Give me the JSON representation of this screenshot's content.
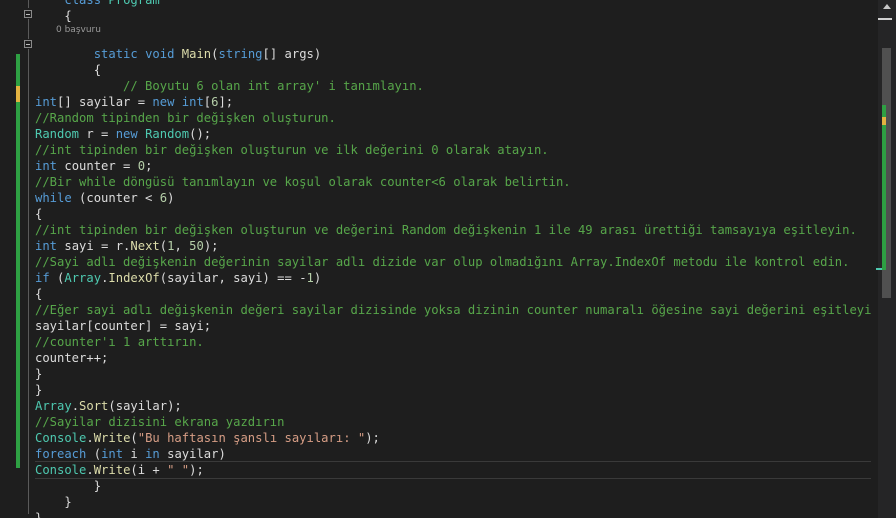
{
  "editor": {
    "codelens": "0 başvuru",
    "lines": [
      [
        {
          "c": "",
          "t": "    "
        },
        {
          "c": "t-kw",
          "t": "class"
        },
        {
          "c": "",
          "t": " "
        },
        {
          "c": "t-type",
          "t": "Program"
        }
      ],
      [
        {
          "c": "",
          "t": "    {"
        }
      ],
      [],
      [
        {
          "c": "",
          "t": "        "
        },
        {
          "c": "t-kw",
          "t": "static"
        },
        {
          "c": "",
          "t": " "
        },
        {
          "c": "t-kw",
          "t": "void"
        },
        {
          "c": "",
          "t": " "
        },
        {
          "c": "t-mth",
          "t": "Main"
        },
        {
          "c": "",
          "t": "("
        },
        {
          "c": "t-kw",
          "t": "string"
        },
        {
          "c": "",
          "t": "[] args)"
        }
      ],
      [
        {
          "c": "",
          "t": "        {"
        }
      ],
      [
        {
          "c": "t-cm",
          "t": "            // Boyutu 6 olan int array' i tanımlayın."
        }
      ],
      [
        {
          "c": "t-kw",
          "t": "int"
        },
        {
          "c": "",
          "t": "[] sayilar = "
        },
        {
          "c": "t-kw",
          "t": "new"
        },
        {
          "c": "",
          "t": " "
        },
        {
          "c": "t-kw",
          "t": "int"
        },
        {
          "c": "",
          "t": "["
        },
        {
          "c": "t-num",
          "t": "6"
        },
        {
          "c": "",
          "t": "];"
        }
      ],
      [
        {
          "c": "t-cm",
          "t": "//Random tipinden bir değişken oluşturun."
        }
      ],
      [
        {
          "c": "t-type",
          "t": "Random"
        },
        {
          "c": "",
          "t": " r = "
        },
        {
          "c": "t-kw",
          "t": "new"
        },
        {
          "c": "",
          "t": " "
        },
        {
          "c": "t-type",
          "t": "Random"
        },
        {
          "c": "",
          "t": "();"
        }
      ],
      [
        {
          "c": "t-cm",
          "t": "//int tipinden bir değişken oluşturun ve ilk değerini 0 olarak atayın."
        }
      ],
      [
        {
          "c": "t-kw",
          "t": "int"
        },
        {
          "c": "",
          "t": " counter = "
        },
        {
          "c": "t-num",
          "t": "0"
        },
        {
          "c": "",
          "t": ";"
        }
      ],
      [
        {
          "c": "t-cm",
          "t": "//Bir while döngüsü tanımlayın ve koşul olarak counter<6 olarak belirtin."
        }
      ],
      [
        {
          "c": "t-kw",
          "t": "while"
        },
        {
          "c": "",
          "t": " (counter < "
        },
        {
          "c": "t-num",
          "t": "6"
        },
        {
          "c": "",
          "t": ")"
        }
      ],
      [
        {
          "c": "",
          "t": "{"
        }
      ],
      [
        {
          "c": "t-cm",
          "t": "//int tipinden bir değişken oluşturun ve değerini Random değişkenin 1 ile 49 arası ürettiği tamsayıya eşitleyin."
        }
      ],
      [
        {
          "c": "t-kw",
          "t": "int"
        },
        {
          "c": "",
          "t": " sayi = r."
        },
        {
          "c": "t-mth",
          "t": "Next"
        },
        {
          "c": "",
          "t": "("
        },
        {
          "c": "t-num",
          "t": "1"
        },
        {
          "c": "",
          "t": ", "
        },
        {
          "c": "t-num",
          "t": "50"
        },
        {
          "c": "",
          "t": ");"
        }
      ],
      [
        {
          "c": "t-cm",
          "t": "//Sayi adlı değişkenin değerinin sayilar adlı dizide var olup olmadığını Array.IndexOf metodu ile kontrol edin."
        }
      ],
      [
        {
          "c": "t-kw",
          "t": "if"
        },
        {
          "c": "",
          "t": " ("
        },
        {
          "c": "t-type",
          "t": "Array"
        },
        {
          "c": "",
          "t": "."
        },
        {
          "c": "t-mth",
          "t": "IndexOf"
        },
        {
          "c": "",
          "t": "(sayilar, sayi) == -"
        },
        {
          "c": "t-num",
          "t": "1"
        },
        {
          "c": "",
          "t": ")"
        }
      ],
      [
        {
          "c": "",
          "t": "{"
        }
      ],
      [
        {
          "c": "t-cm",
          "t": "//Eğer sayi adlı değişkenin değeri sayilar dizisinde yoksa dizinin counter numaralı öğesine sayi değerini eşitleyin."
        }
      ],
      [
        {
          "c": "",
          "t": "sayilar[counter] = sayi;"
        }
      ],
      [
        {
          "c": "t-cm",
          "t": "//counter'ı 1 arttırın."
        }
      ],
      [
        {
          "c": "",
          "t": "counter++;"
        }
      ],
      [
        {
          "c": "",
          "t": "}"
        }
      ],
      [
        {
          "c": "",
          "t": "}"
        }
      ],
      [
        {
          "c": "t-type",
          "t": "Array"
        },
        {
          "c": "",
          "t": "."
        },
        {
          "c": "t-mth",
          "t": "Sort"
        },
        {
          "c": "",
          "t": "(sayilar);"
        }
      ],
      [
        {
          "c": "t-cm",
          "t": "//Sayilar dizisini ekrana yazdırın"
        }
      ],
      [
        {
          "c": "t-type",
          "t": "Console"
        },
        {
          "c": "",
          "t": "."
        },
        {
          "c": "t-mth",
          "t": "Write"
        },
        {
          "c": "",
          "t": "("
        },
        {
          "c": "t-str",
          "t": "\"Bu haftasın şanslı sayıları: \""
        },
        {
          "c": "",
          "t": ");"
        }
      ],
      [
        {
          "c": "t-kw",
          "t": "foreach"
        },
        {
          "c": "",
          "t": " ("
        },
        {
          "c": "t-kw",
          "t": "int"
        },
        {
          "c": "",
          "t": " i "
        },
        {
          "c": "t-kw",
          "t": "in"
        },
        {
          "c": "",
          "t": " sayilar)"
        }
      ],
      [
        {
          "c": "t-type",
          "t": "Console"
        },
        {
          "c": "",
          "t": "."
        },
        {
          "c": "t-mth",
          "t": "Write"
        },
        {
          "c": "",
          "t": "(i + "
        },
        {
          "c": "t-str",
          "t": "\" \""
        },
        {
          "c": "",
          "t": ");"
        }
      ],
      [
        {
          "c": "",
          "t": "        }"
        }
      ],
      [
        {
          "c": "",
          "t": "    }"
        }
      ],
      [
        {
          "c": "",
          "t": "}"
        }
      ]
    ]
  }
}
